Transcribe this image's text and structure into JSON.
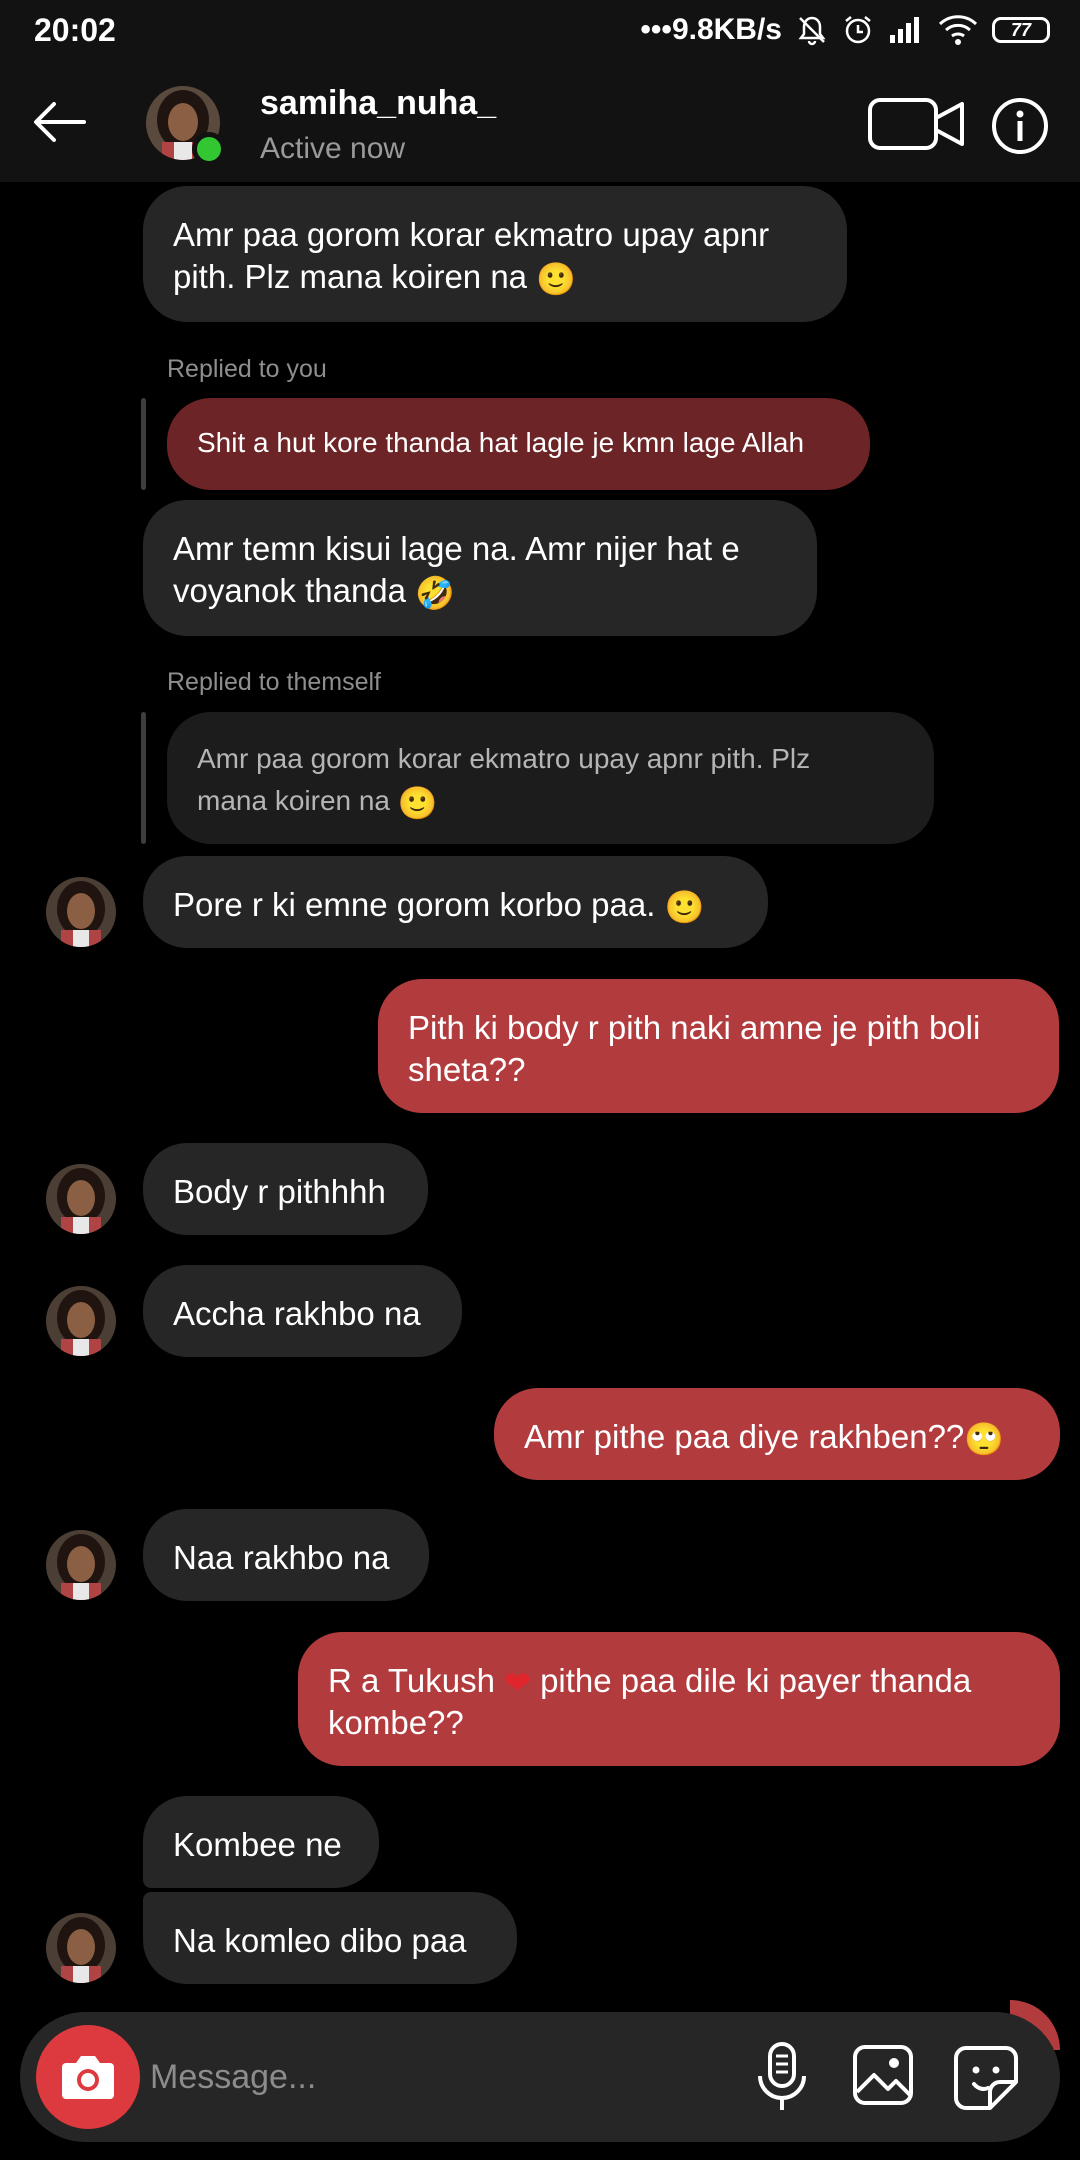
{
  "status_bar": {
    "time": "20:02",
    "network_speed": "9.8KB/s",
    "battery": "77",
    "icons": [
      "dots-icon",
      "mute-bell-icon",
      "alarm-icon",
      "signal-icon",
      "wifi-icon",
      "battery-icon"
    ]
  },
  "header": {
    "username": "samiha_nuha_",
    "status": "Active now",
    "online_color": "#32c732",
    "icons": [
      "back-arrow-icon",
      "video-call-icon",
      "info-icon"
    ]
  },
  "messages": {
    "m1": {
      "text": "Amr paa gorom korar ekmatro upay apnr",
      "text2": "pith. Plz mana koiren na"
    },
    "reply1": {
      "label": "Replied to you",
      "quote": "Shit a hut kore thanda hat lagle je kmn lage Allah"
    },
    "m2": {
      "text": "Amr temn kisui lage na. Amr nijer hat e",
      "text2": "voyanok thanda"
    },
    "reply2": {
      "label": "Replied to themself",
      "quote1": "Amr paa gorom korar ekmatro upay apnr pith. Plz",
      "quote2": "mana koiren na"
    },
    "m3": {
      "text": "Pore r ki emne gorom korbo paa."
    },
    "m4": {
      "text": "Pith ki body r pith naki amne je pith boli",
      "text2": "sheta??"
    },
    "m5": {
      "text": "Body r pithhhh"
    },
    "m6": {
      "text": "Accha rakhbo na"
    },
    "m7": {
      "text": "Amr pithe paa diye rakhben??"
    },
    "m8": {
      "text": "Naa rakhbo na"
    },
    "m9": {
      "text": "R a Tukush",
      "text_after": "pithe paa dile ki payer thanda",
      "text2": "kombe??"
    },
    "m10": {
      "text": "Kombee ne"
    },
    "m11": {
      "text": "Na komleo dibo paa"
    }
  },
  "composer": {
    "placeholder": "Message...",
    "icons": [
      "camera-icon",
      "microphone-icon",
      "gallery-icon",
      "sticker-icon"
    ]
  },
  "colors": {
    "incoming_bubble": "#262626",
    "outgoing_bubble": "#b23b3e",
    "reply_quote_red": "#6c2426",
    "background": "#000000"
  }
}
